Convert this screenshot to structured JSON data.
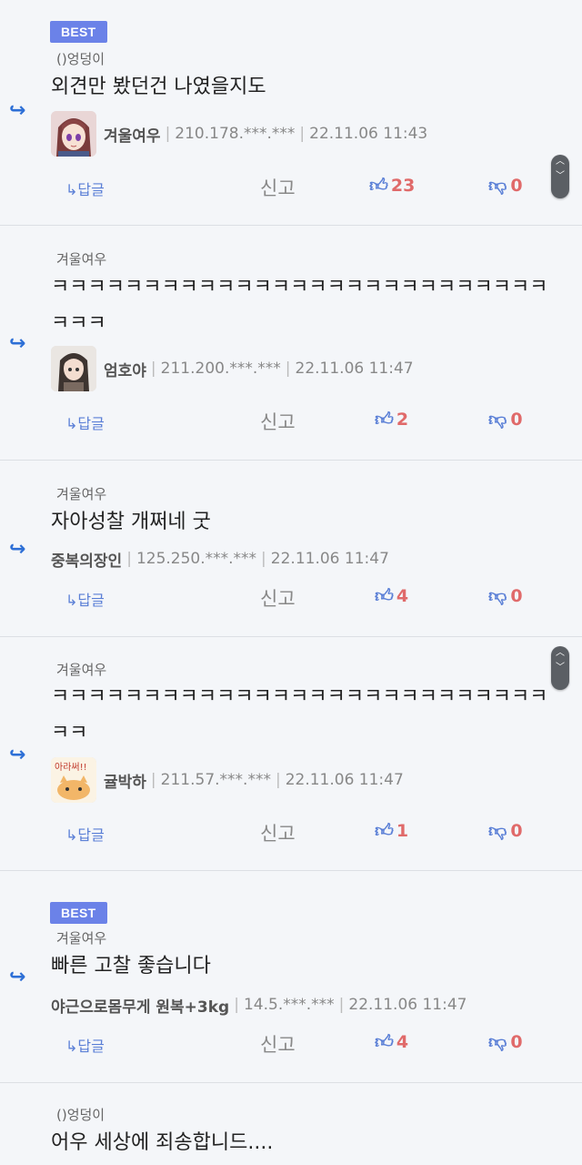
{
  "labels": {
    "reply": "답글",
    "report": "신고",
    "best": "BEST"
  },
  "comments": [
    {
      "best": true,
      "reply_to": "()엉덩이",
      "text": "외견만 봤던건 나였을지도",
      "avatar": "anime-girl-avatar",
      "nick": "겨울여우",
      "ip": "210.178.***.***",
      "date": "22.11.06 11:43",
      "likes": "23",
      "dislikes": "0"
    },
    {
      "best": false,
      "reply_to": "겨울여우",
      "text": "ㅋㅋㅋㅋㅋㅋㅋㅋㅋㅋㅋㅋㅋㅋㅋㅋㅋㅋㅋㅋㅋㅋㅋㅋㅋㅋㅋㅋㅋㅋ",
      "avatar": "dark-hair-girl-avatar",
      "nick": "엄호야",
      "ip": "211.200.***.***",
      "date": "22.11.06 11:47",
      "likes": "2",
      "dislikes": "0"
    },
    {
      "best": false,
      "reply_to": "겨울여우",
      "text": "자아성찰 개쩌네 굿",
      "avatar": "",
      "nick": "중복의장인",
      "ip": "125.250.***.***",
      "date": "22.11.06 11:47",
      "likes": "4",
      "dislikes": "0"
    },
    {
      "best": false,
      "reply_to": "겨울여우",
      "text": "ㅋㅋㅋㅋㅋㅋㅋㅋㅋㅋㅋㅋㅋㅋㅋㅋㅋㅋㅋㅋㅋㅋㅋㅋㅋㅋㅋㅋㅋ",
      "avatar": "cartoon-cat-avatar",
      "avatar_text": "아라써!!",
      "nick": "귤박하",
      "ip": "211.57.***.***",
      "date": "22.11.06 11:47",
      "likes": "1",
      "dislikes": "0"
    },
    {
      "best": true,
      "reply_to": "겨울여우",
      "text": "빠른 고찰 좋습니다",
      "avatar": "",
      "nick": "야근으로몸무게 원복+3kg",
      "ip": "14.5.***.***",
      "date": "22.11.06 11:47",
      "likes": "4",
      "dislikes": "0"
    },
    {
      "best": false,
      "reply_to": "()엉덩이",
      "text": "어우 세상에 죄송합니드....",
      "avatar": "",
      "nick": "",
      "ip": "",
      "date": "",
      "likes": "",
      "dislikes": ""
    }
  ],
  "colors": {
    "background": "#f4f6f9",
    "accent_blue": "#5a7fd6",
    "best_badge": "#6b82e8",
    "count_red": "#e06a6a"
  },
  "icons": {
    "reply_arrow": "reply-arrow-icon",
    "like": "thumbs-up-icon",
    "dislike": "thumbs-down-icon",
    "scroll": "scroll-handle-icon"
  }
}
